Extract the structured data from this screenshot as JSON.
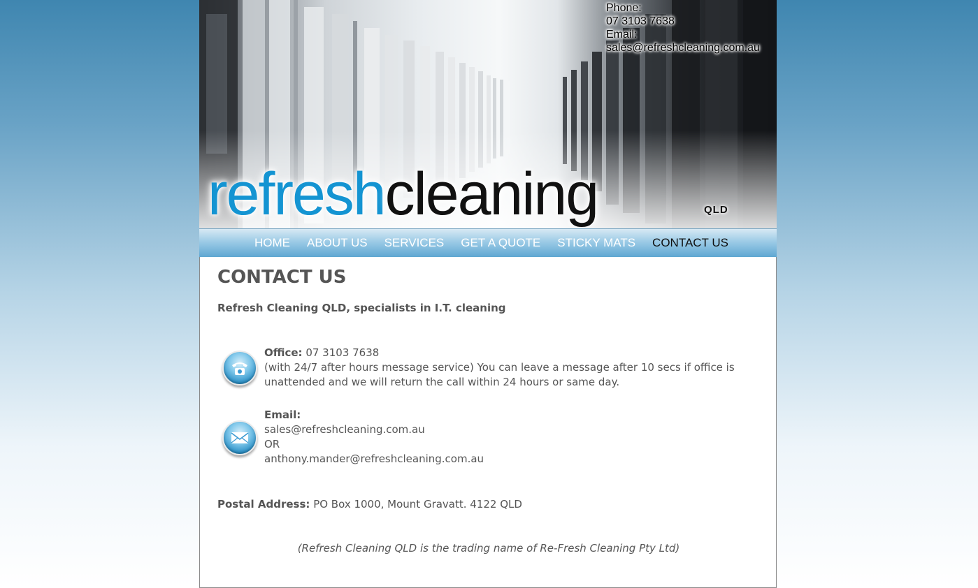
{
  "header": {
    "phone_label": "Phone:",
    "phone": "07 3103 7638",
    "email_label": "Email:",
    "email": "sales@refreshcleaning.com.au",
    "logo_refresh": "refresh",
    "logo_cleaning": "cleaning",
    "logo_qld": "QLD"
  },
  "nav": {
    "items": [
      {
        "label": "HOME"
      },
      {
        "label": "ABOUT US"
      },
      {
        "label": "SERVICES"
      },
      {
        "label": "GET A QUOTE"
      },
      {
        "label": "STICKY MATS"
      },
      {
        "label": "CONTACT US"
      }
    ],
    "active": "CONTACT US"
  },
  "main": {
    "title": "CONTACT US",
    "tagline": "Refresh Cleaning QLD, specialists in I.T. cleaning",
    "office": {
      "label": "Office:",
      "phone": "07 3103 7638",
      "note": "(with 24/7 after hours message service) You can leave a message after 10 secs if office is unattended and we will return the call within 24 hours or same day."
    },
    "email": {
      "label": "Email:",
      "address1": "sales@refreshcleaning.com.au",
      "or": "OR",
      "address2": "anthony.mander@refreshcleaning.com.au"
    },
    "postal": {
      "label": "Postal Address:",
      "value": "PO Box 1000, Mount Gravatt. 4122 QLD"
    },
    "trading_note": "(Refresh Cleaning QLD is the trading name of Re-Fresh Cleaning Pty Ltd)"
  },
  "icons": {
    "office": "telephone-icon",
    "email": "envelope-icon"
  },
  "colors": {
    "brand_blue": "#1494d2",
    "nav_gradient_bottom": "#5fa7d2",
    "text_gray": "#555555"
  }
}
